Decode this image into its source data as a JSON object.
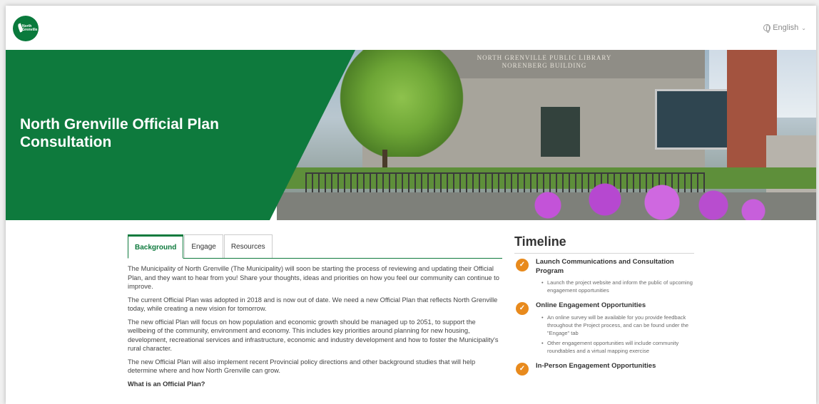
{
  "header": {
    "logo_text": "North Grenville",
    "language_label": "English"
  },
  "hero": {
    "title": "North Grenville Official Plan Consultation",
    "photo_sign": "NORTH GRENVILLE PUBLIC LIBRARY NORENBERG BUILDING"
  },
  "tabs": [
    {
      "label": "Background"
    },
    {
      "label": "Engage"
    },
    {
      "label": "Resources"
    }
  ],
  "article": {
    "p1": "The Municipality of North Grenville (The Municipality) will soon be starting the process of reviewing and updating their Official Plan, and they want to hear from you! Share your thoughts, ideas and priorities on how you feel our community can continue to improve.",
    "p2": "The current Official Plan was adopted in 2018 and is now out of date. We need a new Official Plan that reflects North Grenville today, while creating a new vision for tomorrow.",
    "p3": "The new official Plan will focus on how population and economic growth should be managed up to 2051, to support the wellbeing of the community, environment and economy. This includes key priorities around planning for new housing, development, recreational services and infrastructure, economic and industry development and how to foster the Municipality's rural character.",
    "p4": "The new Official Plan will also implement recent Provincial policy directions and other background studies that will help determine where and how North Grenville can grow.",
    "subhead": "What is an Official Plan?"
  },
  "timeline": {
    "title": "Timeline",
    "items": [
      {
        "heading": "Launch Communications and Consultation Program",
        "bullets": [
          "Launch the project website and inform the public of upcoming engagement opportunities"
        ]
      },
      {
        "heading": "Online Engagement Opportunities",
        "bullets": [
          "An online survey will be available for you provide feedback throughout the Project process, and can be found under the \"Engage\" tab",
          "Other engagement opportunities will include community roundtables and a virtual mapping exercise"
        ]
      },
      {
        "heading": "In-Person Engagement Opportunities",
        "bullets": []
      }
    ]
  },
  "colors": {
    "brand_green": "#0e7a3d",
    "timeline_orange": "#e88a1d"
  }
}
